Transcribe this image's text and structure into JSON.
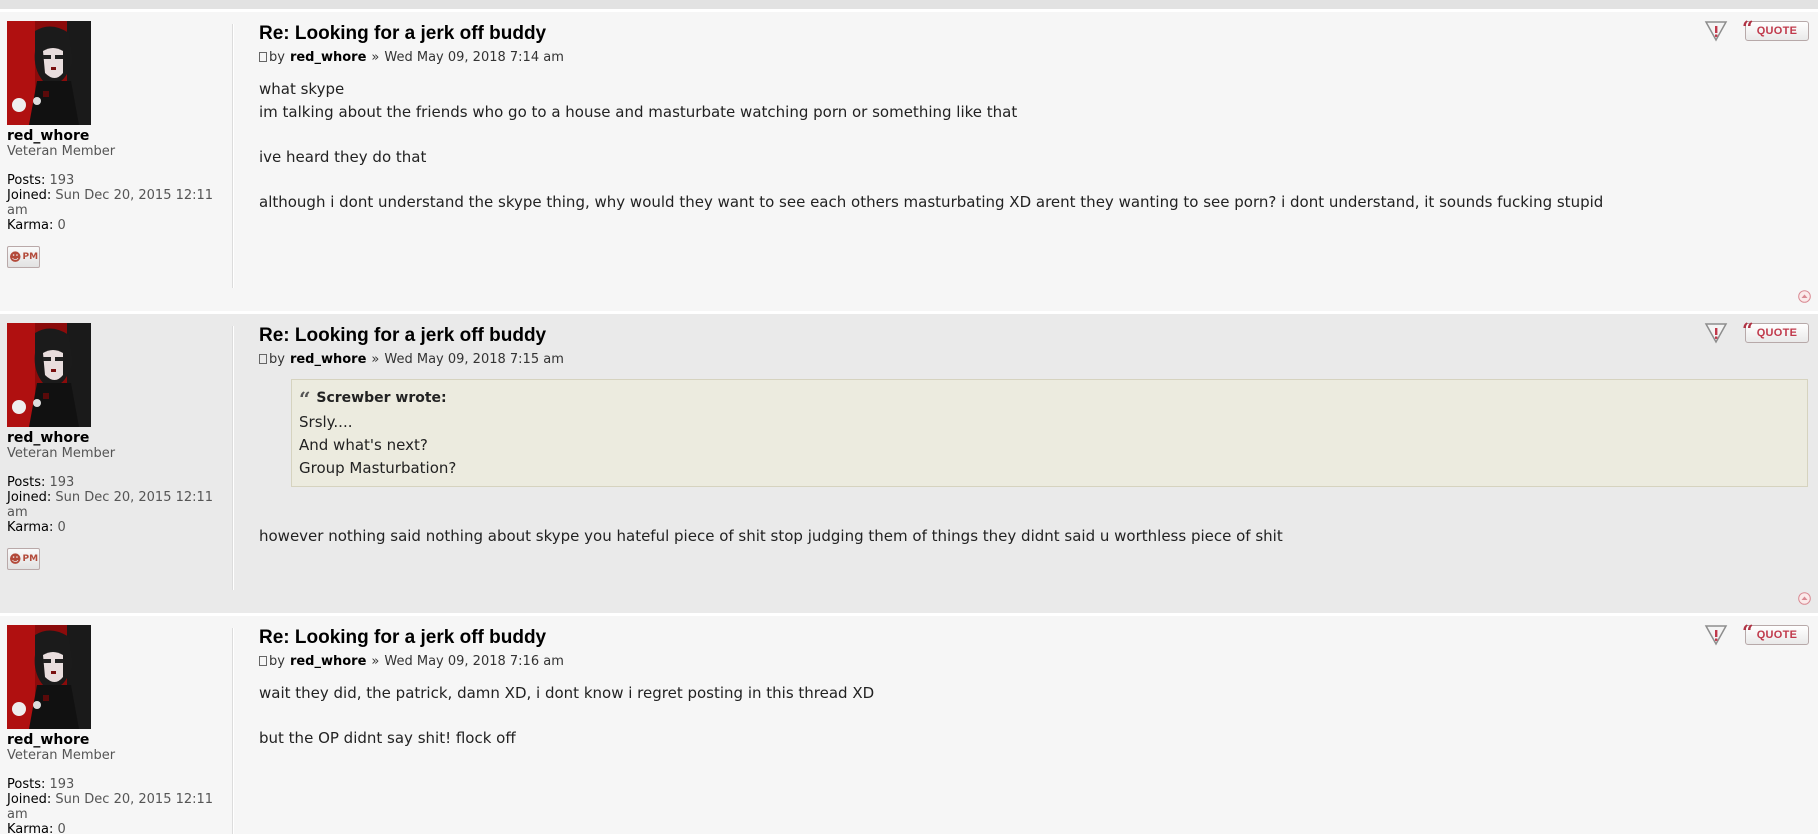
{
  "posts": [
    {
      "title": "Re: Looking for a jerk off buddy",
      "by_label": "by",
      "author": "red_whore",
      "separator": "»",
      "date": "Wed May 09, 2018 7:14 am",
      "username": "red_whore",
      "rank": "Veteran Member",
      "posts_label": "Posts:",
      "posts_value": "193",
      "joined_label": "Joined:",
      "joined_value": "Sun Dec 20, 2015 12:11",
      "joined_value_2": "am",
      "karma_label": "Karma:",
      "karma_value": "0",
      "pm_label": "PM",
      "quote_label": "QUOTE",
      "lines": [
        "what skype",
        "im talking about the friends who go to a house and masturbate watching porn or something like that",
        "ive heard they do that",
        "although i dont understand the skype thing, why would they want to see each others masturbating XD arent they wanting to see porn? i dont understand, it sounds fucking stupid"
      ]
    },
    {
      "title": "Re: Looking for a jerk off buddy",
      "by_label": "by",
      "author": "red_whore",
      "separator": "»",
      "date": "Wed May 09, 2018 7:15 am",
      "username": "red_whore",
      "rank": "Veteran Member",
      "posts_label": "Posts:",
      "posts_value": "193",
      "joined_label": "Joined:",
      "joined_value": "Sun Dec 20, 2015 12:11",
      "joined_value_2": "am",
      "karma_label": "Karma:",
      "karma_value": "0",
      "pm_label": "PM",
      "quote_label": "QUOTE",
      "quote": {
        "cite": "Screwber wrote:",
        "lines": [
          "Srsly....",
          "And what's next?",
          "Group Masturbation?"
        ]
      },
      "lines": [
        "however nothing said nothing about skype you hateful piece of shit stop judging them of things they didnt said u worthless piece of shit"
      ]
    },
    {
      "title": "Re: Looking for a jerk off buddy",
      "by_label": "by",
      "author": "red_whore",
      "separator": "»",
      "date": "Wed May 09, 2018 7:16 am",
      "username": "red_whore",
      "rank": "Veteran Member",
      "posts_label": "Posts:",
      "posts_value": "193",
      "joined_label": "Joined:",
      "joined_value": "Sun Dec 20, 2015 12:11",
      "joined_value_2": "am",
      "karma_label": "Karma:",
      "karma_value": "0",
      "quote_label": "QUOTE",
      "lines": [
        "wait they did, the patrick, damn XD, i dont know i regret posting in this thread XD",
        "but the OP didnt say shit! flock off"
      ]
    }
  ],
  "colors": {
    "post_bg_1": "#f6f6f6",
    "post_bg_2": "#eaeaea",
    "quote_bg": "#ecebdf",
    "quote_button_text": "#c0394b"
  },
  "icons": {
    "report": "warning-triangle-icon",
    "quote": "quote-mark-icon",
    "top": "back-to-top-icon",
    "pm": "private-message-icon"
  }
}
